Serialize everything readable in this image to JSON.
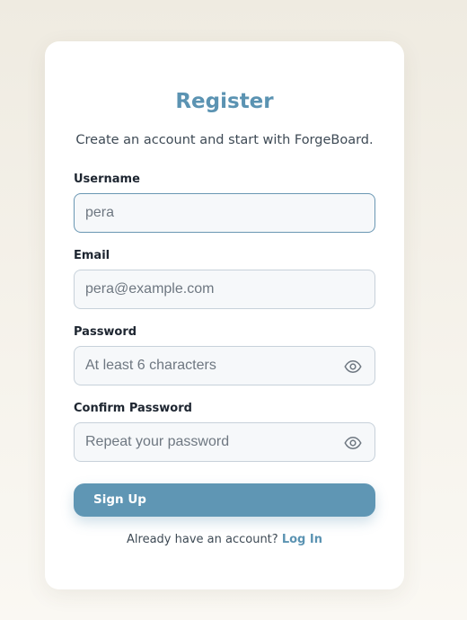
{
  "form": {
    "title": "Register",
    "subtitle": "Create an account and start with ForgeBoard.",
    "fields": [
      {
        "label": "Username",
        "value": "",
        "placeholder": "pera"
      },
      {
        "label": "Email",
        "value": "",
        "placeholder": "pera@example.com"
      },
      {
        "label": "Password",
        "value": "",
        "placeholder": "At least 6 characters",
        "icon": "eye-icon"
      },
      {
        "label": "Confirm Password",
        "value": "",
        "placeholder": "Repeat your password",
        "icon": "eye-icon"
      }
    ],
    "submit_label": "Sign Up",
    "footer_text": "Already have an account?",
    "login_link": "Log In"
  },
  "colors": {
    "accent": "#5f96b4",
    "title": "#5b93b2",
    "background": "#f3f0e8"
  }
}
